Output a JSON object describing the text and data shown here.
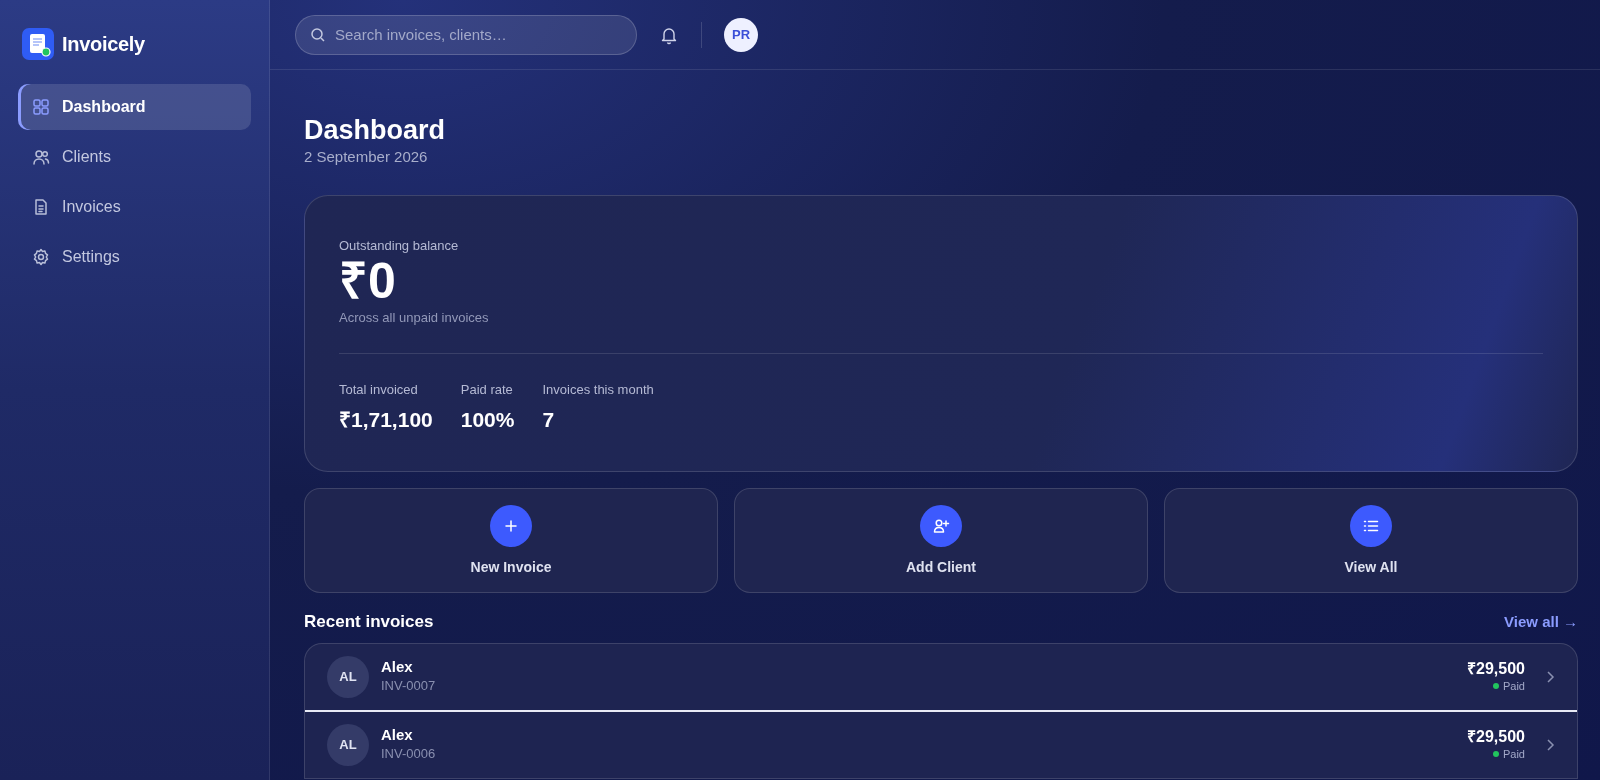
{
  "app": {
    "name": "Invoicely"
  },
  "sidebar": {
    "items": [
      {
        "label": "Dashboard",
        "kind": "grid",
        "selected": true
      },
      {
        "label": "Clients",
        "kind": "users",
        "selected": false
      },
      {
        "label": "Invoices",
        "kind": "doc",
        "selected": false
      },
      {
        "label": "Settings",
        "kind": "gear",
        "selected": false
      }
    ]
  },
  "topbar": {
    "search": {
      "placeholder": "Search invoices, clients…"
    },
    "avatar": "PR"
  },
  "page": {
    "title": "Dashboard",
    "date": "2 September 2026"
  },
  "balance_card": {
    "label": "Outstanding balance",
    "amount": "₹0",
    "caption": "Across all unpaid invoices",
    "stats": [
      {
        "label": "Total invoiced",
        "value": "₹1,71,100"
      },
      {
        "label": "Paid rate",
        "value": "100%"
      },
      {
        "label": "Invoices this month",
        "value": "7"
      }
    ]
  },
  "actions": [
    {
      "label": "New Invoice",
      "kind": "plus"
    },
    {
      "label": "Add Client",
      "kind": "user-plus"
    },
    {
      "label": "View All",
      "kind": "list"
    }
  ],
  "recent": {
    "title": "Recent invoices",
    "link": "View all →",
    "invoices": [
      {
        "initials": "AL",
        "client": "Alex",
        "number": "INV-0007",
        "amount": "₹29,500",
        "status": "Paid",
        "color": "#22c55e"
      },
      {
        "initials": "AL",
        "client": "Alex",
        "number": "INV-0006",
        "amount": "₹29,500",
        "status": "Paid",
        "color": "#22c55e"
      }
    ]
  }
}
